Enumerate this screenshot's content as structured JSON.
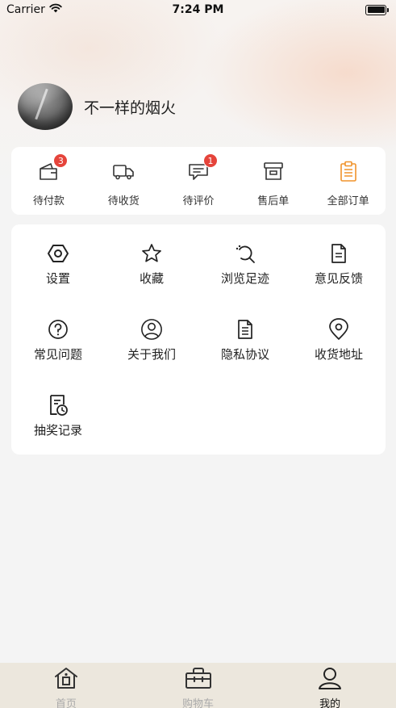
{
  "status_bar": {
    "carrier": "Carrier",
    "time": "7:24 PM"
  },
  "profile": {
    "username": "不一样的烟火"
  },
  "orders": [
    {
      "label": "待付款",
      "icon": "wallet-icon",
      "badge": "3"
    },
    {
      "label": "待收货",
      "icon": "truck-icon",
      "badge": ""
    },
    {
      "label": "待评价",
      "icon": "comment-icon",
      "badge": "1"
    },
    {
      "label": "售后单",
      "icon": "archive-box-icon",
      "badge": ""
    },
    {
      "label": "全部订单",
      "icon": "clipboard-list-icon",
      "badge": ""
    }
  ],
  "menu": [
    {
      "label": "设置",
      "icon": "settings-hexagon-icon"
    },
    {
      "label": "收藏",
      "icon": "star-icon"
    },
    {
      "label": "浏览足迹",
      "icon": "history-magnifier-icon"
    },
    {
      "label": "意见反馈",
      "icon": "document-icon"
    },
    {
      "label": "常见问题",
      "icon": "question-circle-icon"
    },
    {
      "label": "关于我们",
      "icon": "user-circle-icon"
    },
    {
      "label": "隐私协议",
      "icon": "document-lines-icon"
    },
    {
      "label": "收货地址",
      "icon": "location-pin-icon"
    },
    {
      "label": "抽奖记录",
      "icon": "record-clock-icon"
    }
  ],
  "tabbar": [
    {
      "label": "首页",
      "icon": "home-icon",
      "active": false
    },
    {
      "label": "购物车",
      "icon": "shopping-bag-icon",
      "active": false
    },
    {
      "label": "我的",
      "icon": "user-icon",
      "active": true
    }
  ],
  "colors": {
    "badge": "#e5443b",
    "accent_orange": "#f0932b",
    "tabbar_bg": "#ece7dd"
  }
}
